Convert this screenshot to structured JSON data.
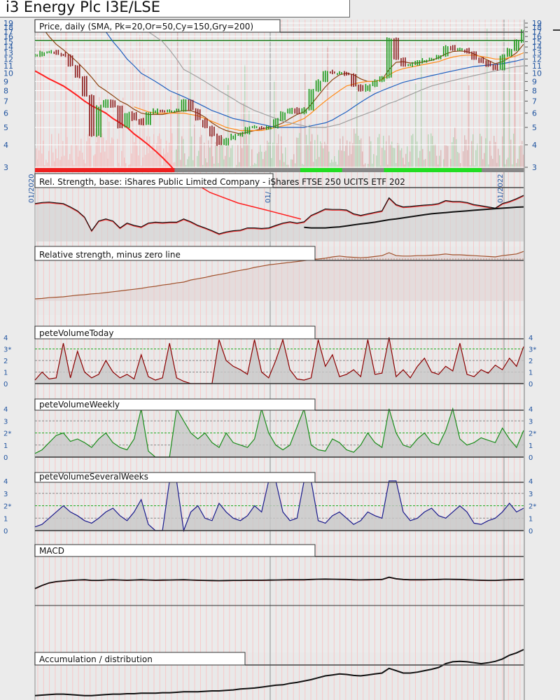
{
  "title": "i3 Energy Plc I3E/LSE",
  "chart_data": [
    {
      "type": "line",
      "panel": "price",
      "title": "Price, daily (SMA, Pk=20,Or=50,Cy=150,Gry=200)",
      "yscale": "log",
      "ylim": [
        3,
        19
      ],
      "yticks": [
        "3",
        "4",
        "5",
        "6",
        "7",
        "8",
        "9",
        "10",
        "11",
        "12",
        "13",
        "14",
        "15",
        "16",
        "17",
        "18",
        "19"
      ],
      "x_labels": [
        "01/2020",
        "01/",
        "01/2022"
      ],
      "resistance_level": 15.2,
      "series": [
        {
          "name": "price",
          "color": "#1a8c1a",
          "values": [
            12.5,
            13,
            13.2,
            12.8,
            12.5,
            11,
            9.5,
            7.5,
            4.5,
            6.5,
            7,
            6.5,
            5,
            6,
            5.5,
            5.2,
            6,
            6.2,
            6.1,
            6.2,
            6.2,
            7,
            6.3,
            5.5,
            5,
            4.5,
            4,
            4.3,
            4.5,
            4.6,
            5,
            5,
            4.9,
            5,
            5.5,
            6,
            6.3,
            6,
            6.3,
            8,
            9,
            10.2,
            10,
            10,
            9.8,
            8.5,
            8,
            8.5,
            9,
            9.5,
            15.5,
            12,
            11,
            11.2,
            11.5,
            11.8,
            12,
            12.5,
            14,
            13.5,
            13.5,
            13,
            12,
            11.5,
            11,
            10.5,
            12.5,
            13.5,
            15,
            17
          ]
        },
        {
          "name": "SMA 20",
          "color": "#8b4513",
          "values": [
            20,
            18,
            16,
            14.5,
            13.5,
            12.5,
            11.5,
            10.5,
            9.5,
            8.5,
            8,
            7.5,
            7,
            6.7,
            6.3,
            6,
            5.9,
            5.9,
            5.9,
            6,
            6.1,
            6.2,
            6.2,
            6,
            5.7,
            5.3,
            5,
            4.8,
            4.7,
            4.6,
            4.7,
            4.8,
            4.9,
            5,
            5.1,
            5.3,
            5.6,
            5.9,
            6.1,
            6.7,
            7.5,
            8.4,
            9.2,
            9.8,
            10,
            9.8,
            9.3,
            9,
            9,
            9.2,
            10.5,
            11.5,
            11.6,
            11.4,
            11.4,
            11.6,
            11.8,
            12.2,
            12.8,
            13.2,
            13.3,
            13.2,
            12.8,
            12.3,
            11.8,
            11.3,
            11.6,
            12.2,
            13,
            14.5
          ]
        },
        {
          "name": "SMA 50",
          "color": "#ff8c1a",
          "values": [
            null,
            null,
            null,
            null,
            null,
            null,
            null,
            null,
            null,
            null,
            null,
            null,
            null,
            null,
            6.5,
            6.3,
            6.1,
            6,
            6,
            6,
            6,
            6,
            5.9,
            5.8,
            5.6,
            5.4,
            5.2,
            5,
            4.9,
            4.8,
            4.8,
            4.8,
            4.8,
            4.9,
            5,
            5.1,
            5.2,
            5.4,
            5.6,
            6,
            6.5,
            7,
            7.5,
            8,
            8.5,
            8.7,
            8.9,
            9,
            9,
            9.2,
            9.8,
            10.3,
            10.6,
            10.8,
            11,
            11.2,
            11.4,
            11.6,
            12,
            12.3,
            12.5,
            12.6,
            12.6,
            12.4,
            12.2,
            12,
            12,
            12.2,
            12.5,
            13
          ]
        },
        {
          "name": "SMA 150",
          "color": "#1f5fbf",
          "values": [
            30,
            28,
            26,
            24,
            22,
            21,
            20,
            19.5,
            19,
            18,
            17,
            15,
            13.5,
            12,
            11,
            10,
            9.5,
            9,
            8.5,
            8,
            7.7,
            7.4,
            7.1,
            6.8,
            6.5,
            6.2,
            6,
            5.8,
            5.6,
            5.5,
            5.4,
            5.3,
            5.2,
            5.1,
            5,
            5,
            5,
            5,
            5,
            5.1,
            5.2,
            5.3,
            5.5,
            5.8,
            6.1,
            6.5,
            6.9,
            7.3,
            7.7,
            8,
            8.3,
            8.6,
            8.9,
            9.1,
            9.3,
            9.5,
            9.7,
            9.9,
            10.1,
            10.3,
            10.5,
            10.7,
            10.9,
            11,
            11.1,
            11.2,
            11.3,
            11.5,
            11.7,
            12
          ]
        },
        {
          "name": "SMA 200",
          "color": "#a0a0a0",
          "values": [
            null,
            null,
            null,
            null,
            null,
            null,
            null,
            null,
            null,
            null,
            null,
            null,
            null,
            null,
            22,
            19,
            17,
            16,
            15,
            13.5,
            12,
            10.5,
            10,
            9.5,
            9,
            8.5,
            8,
            7.6,
            7.2,
            6.8,
            6.5,
            6.2,
            6,
            5.8,
            5.6,
            5.4,
            5.3,
            5.2,
            5.1,
            5,
            5,
            5,
            5.1,
            5.2,
            5.4,
            5.6,
            5.8,
            6,
            6.2,
            6.5,
            6.8,
            7,
            7.3,
            7.6,
            7.9,
            8.2,
            8.5,
            8.7,
            8.9,
            9.1,
            9.3,
            9.5,
            9.7,
            9.9,
            10.1,
            10.3,
            10.5,
            10.7,
            10.9,
            11
          ]
        },
        {
          "name": "trailing stop",
          "color": "#ff2020",
          "values": [
            10.3,
            9.8,
            9.3,
            8.9,
            8.5,
            8,
            7.5,
            7,
            6.6,
            6.3,
            6,
            5.6,
            5.3,
            5,
            4.6,
            4.3,
            4,
            3.7,
            3.4,
            3.1,
            2.8
          ]
        }
      ]
    },
    {
      "type": "line",
      "panel": "rs",
      "title": "Rel. Strength, base: iShares Public Limited Company - iShares FTSE 250 UCITS ETF 202"
    },
    {
      "type": "line",
      "panel": "rs_zero",
      "title": "Relative strength, minus zero line",
      "values": [
        0.05,
        0.06,
        0.08,
        0.09,
        0.1,
        0.12,
        0.14,
        0.15,
        0.17,
        0.18,
        0.2,
        0.22,
        0.24,
        0.26,
        0.28,
        0.3,
        0.33,
        0.35,
        0.38,
        0.4,
        0.43,
        0.45,
        0.5,
        0.53,
        0.56,
        0.6,
        0.63,
        0.66,
        0.7,
        0.73,
        0.76,
        0.8,
        0.83,
        0.86,
        0.88,
        0.9,
        0.92,
        0.94,
        0.96,
        0.98,
        1.0,
        1.02,
        1.05,
        1.07,
        1.05,
        1.04,
        1.03,
        1.04,
        1.06,
        1.08,
        1.15,
        1.08,
        1.07,
        1.07,
        1.08,
        1.08,
        1.09,
        1.1,
        1.12,
        1.1,
        1.1,
        1.09,
        1.08,
        1.07,
        1.06,
        1.05,
        1.08,
        1.1,
        1.12,
        1.18
      ]
    },
    {
      "type": "area",
      "panel": "pv_today",
      "title": "peteVolumeToday",
      "color": "#8b0000",
      "ylim": [
        0,
        4
      ],
      "yticks": [
        "0",
        "1",
        "2",
        "3*",
        "4"
      ],
      "values": [
        0.3,
        1,
        0.4,
        0.5,
        3.5,
        0.5,
        2.8,
        1,
        0.5,
        0.8,
        2,
        1,
        0.5,
        0.8,
        0.4,
        2.5,
        0.6,
        0.3,
        0.5,
        3.5,
        0.5,
        0.2,
        0,
        0,
        0,
        0,
        3.8,
        2,
        1.5,
        1.2,
        0.8,
        3.8,
        1,
        0.5,
        2,
        3.8,
        1.2,
        0.4,
        0.3,
        0.5,
        3.8,
        1.5,
        2.5,
        0.6,
        0.8,
        1.2,
        0.6,
        3.8,
        0.8,
        0.9,
        4,
        0.6,
        1.2,
        0.5,
        1.5,
        2.2,
        1,
        0.8,
        1.5,
        1.1,
        3.5,
        0.8,
        0.6,
        1.2,
        0.9,
        1.6,
        1.2,
        2.2,
        1.5,
        3.2
      ]
    },
    {
      "type": "area",
      "panel": "pv_weekly",
      "title": "peteVolumeWeekly",
      "color": "#1a8c1a",
      "ylim": [
        0,
        4
      ],
      "yticks": [
        "0",
        "1",
        "2*",
        "3",
        "4"
      ],
      "values": [
        0.3,
        0.6,
        1.2,
        1.8,
        2,
        1.3,
        1.5,
        1.2,
        0.8,
        1.5,
        2,
        1.2,
        0.8,
        0.6,
        1.5,
        4,
        0.5,
        0,
        0,
        0,
        4,
        3,
        2,
        1.5,
        2,
        1.2,
        0.8,
        2,
        1.2,
        1,
        0.8,
        1.5,
        4,
        2,
        1,
        0.6,
        1,
        2.5,
        4,
        1,
        0.6,
        0.5,
        1.5,
        1.2,
        0.6,
        0.4,
        1,
        2,
        1.2,
        0.8,
        4,
        2,
        1,
        0.8,
        1.5,
        2,
        1.2,
        1,
        2.2,
        4,
        1.5,
        1,
        1.2,
        1.6,
        1.4,
        1.2,
        2.4,
        1.5,
        0.8,
        2.2
      ]
    },
    {
      "type": "area",
      "panel": "pv_several",
      "title": "peteVolumeSeveralWeeks",
      "color": "#1a1a8c",
      "ylim": [
        0,
        4
      ],
      "yticks": [
        "0",
        "1",
        "2*",
        "3",
        "4"
      ],
      "values": [
        0.3,
        0.5,
        1,
        1.5,
        2,
        1.5,
        1.2,
        0.8,
        0.6,
        1,
        1.5,
        1.8,
        1.2,
        0.8,
        1.5,
        2.5,
        0.5,
        0,
        0,
        4,
        4,
        0,
        1.5,
        2,
        1,
        0.8,
        2.2,
        1.5,
        1,
        0.8,
        1.2,
        2,
        1.5,
        4,
        4,
        1.5,
        0.8,
        1,
        4,
        4,
        0.8,
        0.6,
        1.2,
        1.5,
        1,
        0.5,
        0.8,
        1.5,
        1.2,
        1,
        4.2,
        4,
        1.5,
        0.8,
        1,
        1.5,
        1.8,
        1.2,
        1,
        1.5,
        2,
        1.5,
        0.6,
        0.5,
        0.8,
        1,
        1.5,
        2.2,
        1.5,
        1.8
      ]
    },
    {
      "type": "line",
      "panel": "macd",
      "title": "MACD",
      "values": [
        -0.6,
        -0.35,
        -0.15,
        -0.05,
        0,
        0.05,
        0.08,
        0.1,
        0.05,
        0.05,
        0.08,
        0.1,
        0.08,
        0.06,
        0.08,
        0.1,
        0.08,
        0.06,
        0.07,
        0.08,
        0.09,
        0.1,
        0.08,
        0.06,
        0.05,
        0.04,
        0.03,
        0.04,
        0.05,
        0.05,
        0.06,
        0.06,
        0.06,
        0.07,
        0.08,
        0.09,
        0.1,
        0.1,
        0.1,
        0.12,
        0.14,
        0.15,
        0.14,
        0.13,
        0.12,
        0.1,
        0.09,
        0.1,
        0.11,
        0.12,
        0.3,
        0.18,
        0.12,
        0.1,
        0.1,
        0.1,
        0.11,
        0.12,
        0.14,
        0.13,
        0.12,
        0.1,
        0.08,
        0.06,
        0.05,
        0.05,
        0.08,
        0.1,
        0.11,
        0.12
      ]
    },
    {
      "type": "line",
      "panel": "ad",
      "title": "Accumulation / distribution",
      "values": [
        0.02,
        0.03,
        0.04,
        0.05,
        0.05,
        0.04,
        0.03,
        0.02,
        0.02,
        0.03,
        0.04,
        0.05,
        0.05,
        0.06,
        0.06,
        0.07,
        0.07,
        0.07,
        0.08,
        0.08,
        0.09,
        0.1,
        0.1,
        0.1,
        0.11,
        0.12,
        0.12,
        0.13,
        0.14,
        0.16,
        0.17,
        0.18,
        0.2,
        0.22,
        0.24,
        0.25,
        0.28,
        0.3,
        0.33,
        0.36,
        0.4,
        0.44,
        0.46,
        0.48,
        0.47,
        0.45,
        0.44,
        0.46,
        0.48,
        0.5,
        0.6,
        0.55,
        0.5,
        0.5,
        0.52,
        0.55,
        0.58,
        0.62,
        0.7,
        0.74,
        0.75,
        0.74,
        0.72,
        0.7,
        0.72,
        0.75,
        0.8,
        0.88,
        0.93,
        1.0
      ]
    }
  ],
  "signal_band": [
    "red",
    "red",
    "red",
    "red",
    "red",
    "red",
    "red",
    "red",
    "red",
    "red",
    "red",
    "red",
    "red",
    "red",
    "red",
    "red",
    "red",
    "red",
    "red",
    "red",
    "grey",
    "grey",
    "grey",
    "grey",
    "grey",
    "grey",
    "grey",
    "grey",
    "grey",
    "grey",
    "grey",
    "grey",
    "grey",
    "grey",
    "grey",
    "grey",
    "grey",
    "grey",
    "green",
    "green",
    "green",
    "green",
    "green",
    "green",
    "grey",
    "grey",
    "grey",
    "grey",
    "grey",
    "grey",
    "green",
    "green",
    "green",
    "green",
    "green",
    "green",
    "green",
    "green",
    "green",
    "green",
    "green",
    "green",
    "green",
    "green",
    "grey",
    "grey",
    "grey",
    "grey",
    "grey",
    "grey"
  ]
}
